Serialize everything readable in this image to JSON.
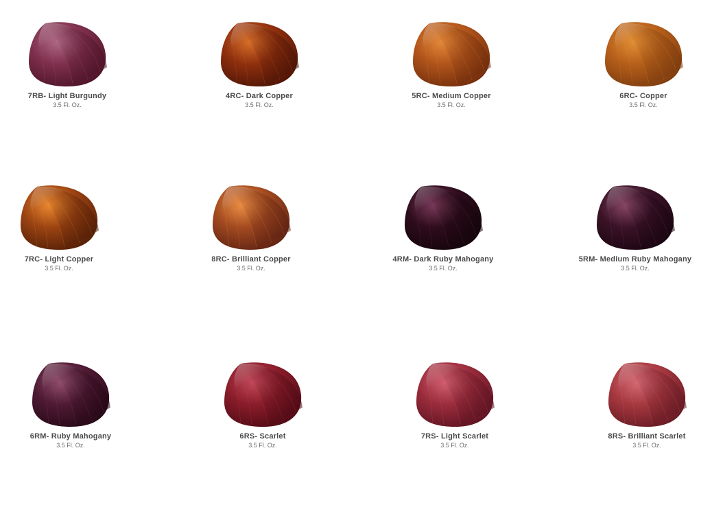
{
  "products": [
    {
      "name": "7RB- Light Burgundy",
      "size": "3.5 Fl. Oz.",
      "colors": {
        "light": "#b06a86",
        "mid": "#7e2f4c",
        "dark": "#4a1226"
      }
    },
    {
      "name": "4RC- Dark Copper",
      "size": "3.5 Fl. Oz.",
      "colors": {
        "light": "#d9702a",
        "mid": "#8e2f0e",
        "dark": "#4a1306"
      }
    },
    {
      "name": "5RC- Medium Copper",
      "size": "3.5 Fl. Oz.",
      "colors": {
        "light": "#e58a3a",
        "mid": "#b0541b",
        "dark": "#6e2b0b"
      }
    },
    {
      "name": "6RC- Copper",
      "size": "3.5 Fl. Oz.",
      "colors": {
        "light": "#e39035",
        "mid": "#b55f1a",
        "dark": "#7a3a0e"
      }
    },
    {
      "name": "7RC- Light Copper",
      "size": "3.5 Fl. Oz.",
      "colors": {
        "light": "#ec8a30",
        "mid": "#9b4312",
        "dark": "#4f1d07"
      }
    },
    {
      "name": "8RC- Brilliant Copper",
      "size": "3.5 Fl. Oz.",
      "colors": {
        "light": "#ec8f44",
        "mid": "#a24a20",
        "dark": "#5c2012"
      }
    },
    {
      "name": "4RM- Dark Ruby Mahogany",
      "size": "3.5 Fl. Oz.",
      "colors": {
        "light": "#7a3a5a",
        "mid": "#2e0c1c",
        "dark": "#13040a"
      }
    },
    {
      "name": "5RM- Medium Ruby Mahogany",
      "size": "3.5 Fl. Oz.",
      "colors": {
        "light": "#8a4868",
        "mid": "#3a1226",
        "dark": "#180510"
      }
    },
    {
      "name": "6RM- Ruby Mahogany",
      "size": "3.5 Fl. Oz.",
      "colors": {
        "light": "#935070",
        "mid": "#4f1a33",
        "dark": "#240715"
      }
    },
    {
      "name": "6RS- Scarlet",
      "size": "3.5 Fl. Oz.",
      "colors": {
        "light": "#c34a5a",
        "mid": "#8a1c2a",
        "dark": "#4c0a14"
      }
    },
    {
      "name": "7RS- Light Scarlet",
      "size": "3.5 Fl. Oz.",
      "colors": {
        "light": "#d26070",
        "mid": "#9a2c3c",
        "dark": "#5a1220"
      }
    },
    {
      "name": "8RS- Brilliant Scarlet",
      "size": "3.5 Fl. Oz.",
      "colors": {
        "light": "#d56c76",
        "mid": "#a6383f",
        "dark": "#631822"
      }
    }
  ]
}
